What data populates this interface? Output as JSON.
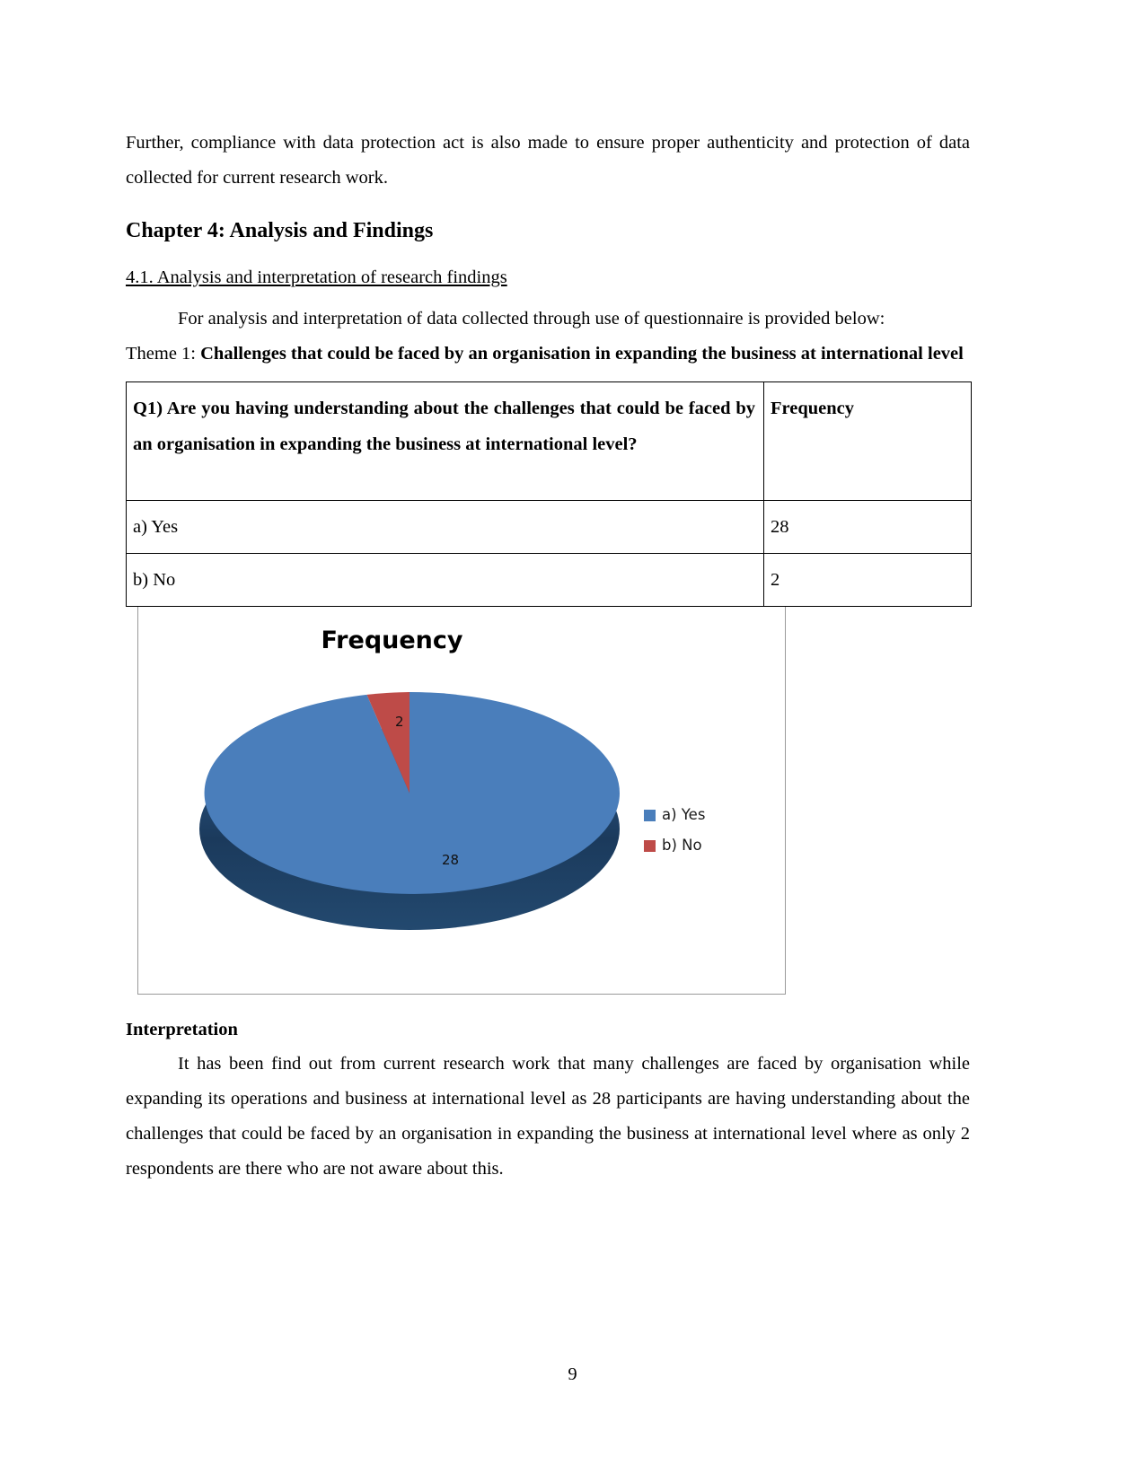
{
  "document": {
    "intro_paragraph": "Further, compliance with data protection act is also made to ensure proper authenticity and protection of data collected for current research work.",
    "chapter_heading": "Chapter 4: Analysis and Findings",
    "section_heading": "4.1. Analysis and interpretation of research findings ",
    "analysis_paragraph": "For analysis and interpretation of data collected through use of questionnaire is provided below:",
    "theme_prefix": "Theme 1: ",
    "theme_title": "Challenges that could be faced by an organisation in expanding the business at international level",
    "interpretation_heading": "Interpretation",
    "interpretation_paragraph": "It has been find out from current research work that many challenges are faced by organisation while expanding its operations and business at international level as 28 participants are having understanding about the challenges that could be faced by an organisation in expanding the business at international level where as only 2 respondents are there who are not aware about this.",
    "page_number": "9"
  },
  "table": {
    "question": "Q1) Are you having understanding about the challenges that could be faced by an organisation in expanding the business at international level?",
    "frequency_header": "Frequency",
    "rows": [
      {
        "option": "a) Yes",
        "frequency": "28"
      },
      {
        "option": "b) No",
        "frequency": "2"
      }
    ]
  },
  "chart_data": {
    "type": "pie",
    "title": "Frequency",
    "categories": [
      "a) Yes",
      "b) No"
    ],
    "values": [
      28,
      2
    ],
    "data_labels": [
      "28",
      "2"
    ],
    "colors": [
      "#4a7ebb",
      "#be4b48"
    ],
    "legend_position": "right",
    "three_d": true,
    "legend": [
      {
        "label": "a) Yes",
        "color": "#4a7ebb"
      },
      {
        "label": "b) No",
        "color": "#be4b48"
      }
    ]
  }
}
